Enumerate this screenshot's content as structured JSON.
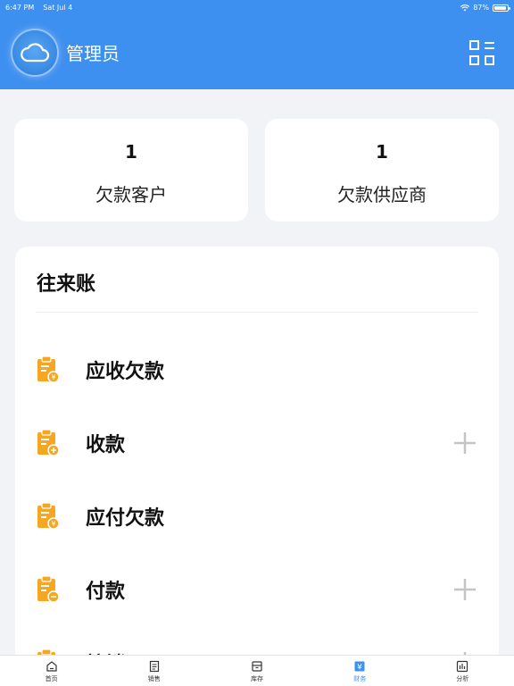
{
  "status": {
    "time": "6:47 PM",
    "date": "Sat Jul 4",
    "battery": "87%"
  },
  "header": {
    "title": "管理员"
  },
  "stats": [
    {
      "value": "1",
      "label": "欠款客户"
    },
    {
      "value": "1",
      "label": "欠款供应商"
    }
  ],
  "accounts": {
    "title": "往来账",
    "items": [
      {
        "label": "应收欠款",
        "addable": false
      },
      {
        "label": "收款",
        "addable": true
      },
      {
        "label": "应付欠款",
        "addable": false
      },
      {
        "label": "付款",
        "addable": true
      },
      {
        "label": "核销",
        "addable": true
      }
    ]
  },
  "tabs": [
    {
      "label": "首页",
      "icon": "home-icon",
      "active": false
    },
    {
      "label": "销售",
      "icon": "sales-icon",
      "active": false
    },
    {
      "label": "库存",
      "icon": "inventory-icon",
      "active": false
    },
    {
      "label": "财务",
      "icon": "finance-icon",
      "active": true
    },
    {
      "label": "分析",
      "icon": "analysis-icon",
      "active": false
    }
  ],
  "colors": {
    "primary": "#3d8ff0",
    "accent_icon": "#f5a623",
    "plus_gray": "#c4c4c4"
  }
}
